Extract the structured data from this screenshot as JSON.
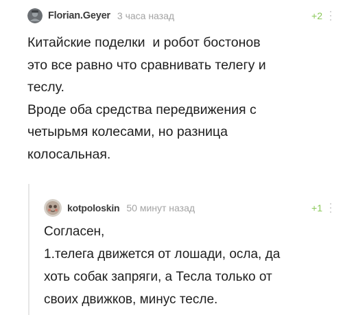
{
  "comments": [
    {
      "author": "Florian.Geyer",
      "time": "3 часа назад",
      "rating": "+2",
      "avatar": "user-avatar",
      "lines": [
        "Китайские поделки  и робот бостонов",
        "это все равно что сравнивать телегу и",
        "теслу.",
        "Вроде оба средства передвижения с",
        "четырьмя колесами, но разница",
        "колосальная."
      ]
    },
    {
      "author": "kotpoloskin",
      "time": "50 минут назад",
      "rating": "+1",
      "avatar": "user-avatar",
      "lines": [
        "Согласен,",
        "1.телега движется от лошади, осла, да",
        "хоть собак запряги, а Тесла только от",
        "своих движков, минус тесле."
      ]
    }
  ],
  "colors": {
    "rating_positive": "#8ac858",
    "meta_gray": "#a3a3a3",
    "thread_line": "#e6e6e6"
  },
  "icons": [
    "user-avatar",
    "more-options-icon"
  ]
}
